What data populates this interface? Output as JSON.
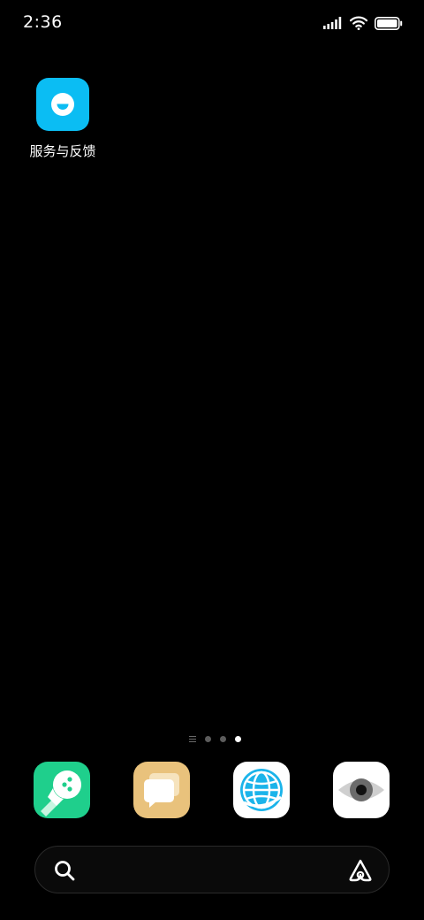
{
  "status_bar": {
    "time": "2:36",
    "signal_icon": "signal-bars-icon",
    "wifi_icon": "wifi-icon",
    "battery_icon": "battery-icon",
    "battery_level": 1.0
  },
  "home_apps": [
    {
      "label": "服务与反馈",
      "icon": "smiley-face-icon",
      "color": "#0bbdf3"
    }
  ],
  "page_indicator": {
    "pages": 3,
    "active_page": 3,
    "list_icon": "page-list-icon"
  },
  "dock": [
    {
      "icon": "green-microphone-app-icon",
      "color": "#1fcf8c"
    },
    {
      "icon": "messages-app-icon",
      "color": "#e9c27c"
    },
    {
      "icon": "globe-browser-app-icon",
      "color": "#ffffff"
    },
    {
      "icon": "eye-app-icon",
      "color": "#ffffff"
    }
  ],
  "search_bar": {
    "search_icon": "search-icon",
    "assistant_icon": "assistant-a-icon"
  },
  "colors": {
    "background": "#000000",
    "accent_blue": "#0bbdf3"
  }
}
